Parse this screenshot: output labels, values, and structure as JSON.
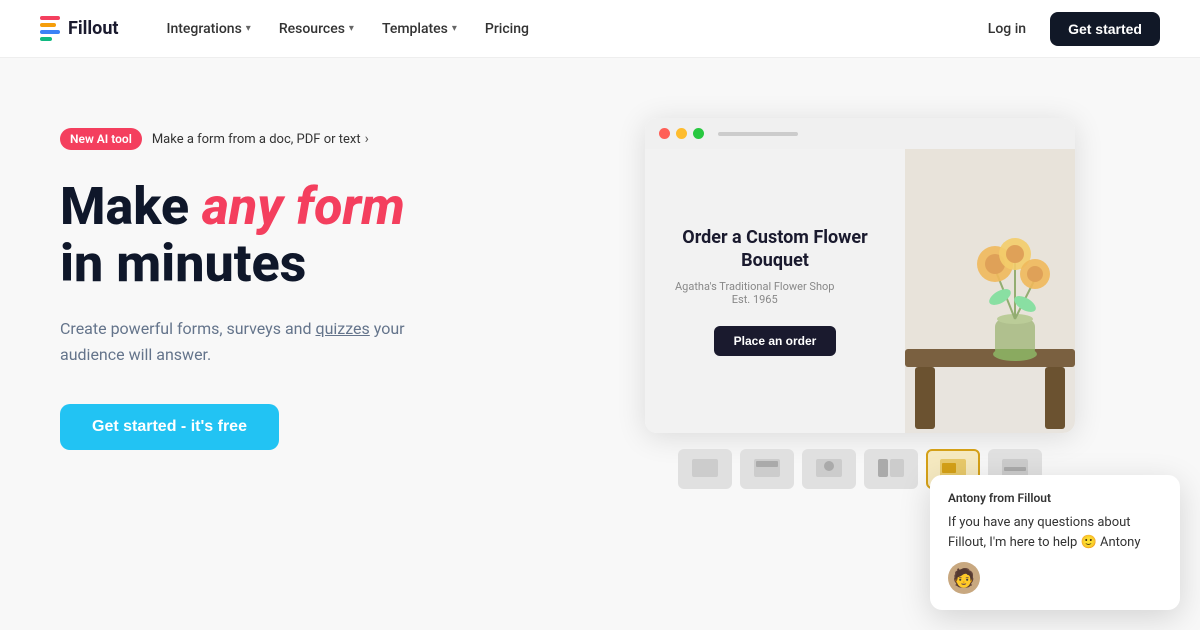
{
  "nav": {
    "logo_text": "Fillout",
    "links": [
      {
        "label": "Integrations",
        "has_chevron": true
      },
      {
        "label": "Resources",
        "has_chevron": true
      },
      {
        "label": "Templates",
        "has_chevron": true
      },
      {
        "label": "Pricing",
        "has_chevron": false
      }
    ],
    "login_label": "Log in",
    "get_started_label": "Get started"
  },
  "hero": {
    "badge_label": "New AI tool",
    "badge_link_text": "Make a form from a doc, PDF or text",
    "headline_part1": "Make ",
    "headline_highlight": "any form",
    "headline_part2": " in minutes",
    "subtext_before_link": "Create powerful forms, surveys and ",
    "subtext_link": "quizzes",
    "subtext_after_link": " your audience will answer.",
    "cta_label": "Get started - it's free"
  },
  "form_preview": {
    "window_dots": [
      "red",
      "yellow",
      "green"
    ],
    "form_title": "Order a Custom Flower Bouquet",
    "shop_name": "Agatha's Traditional Flower Shop",
    "shop_est": "Est. 1965",
    "cta_button": "Place an order",
    "thumbnails": [
      {
        "id": 1,
        "active": false
      },
      {
        "id": 2,
        "active": false
      },
      {
        "id": 3,
        "active": false
      },
      {
        "id": 4,
        "active": false
      },
      {
        "id": 5,
        "active": true
      },
      {
        "id": 6,
        "active": false
      }
    ]
  },
  "chat_widget": {
    "agent_name": "Antony from Fillout",
    "message": "If you have any questions about Fillout, I'm here to help 🙂 Antony"
  }
}
